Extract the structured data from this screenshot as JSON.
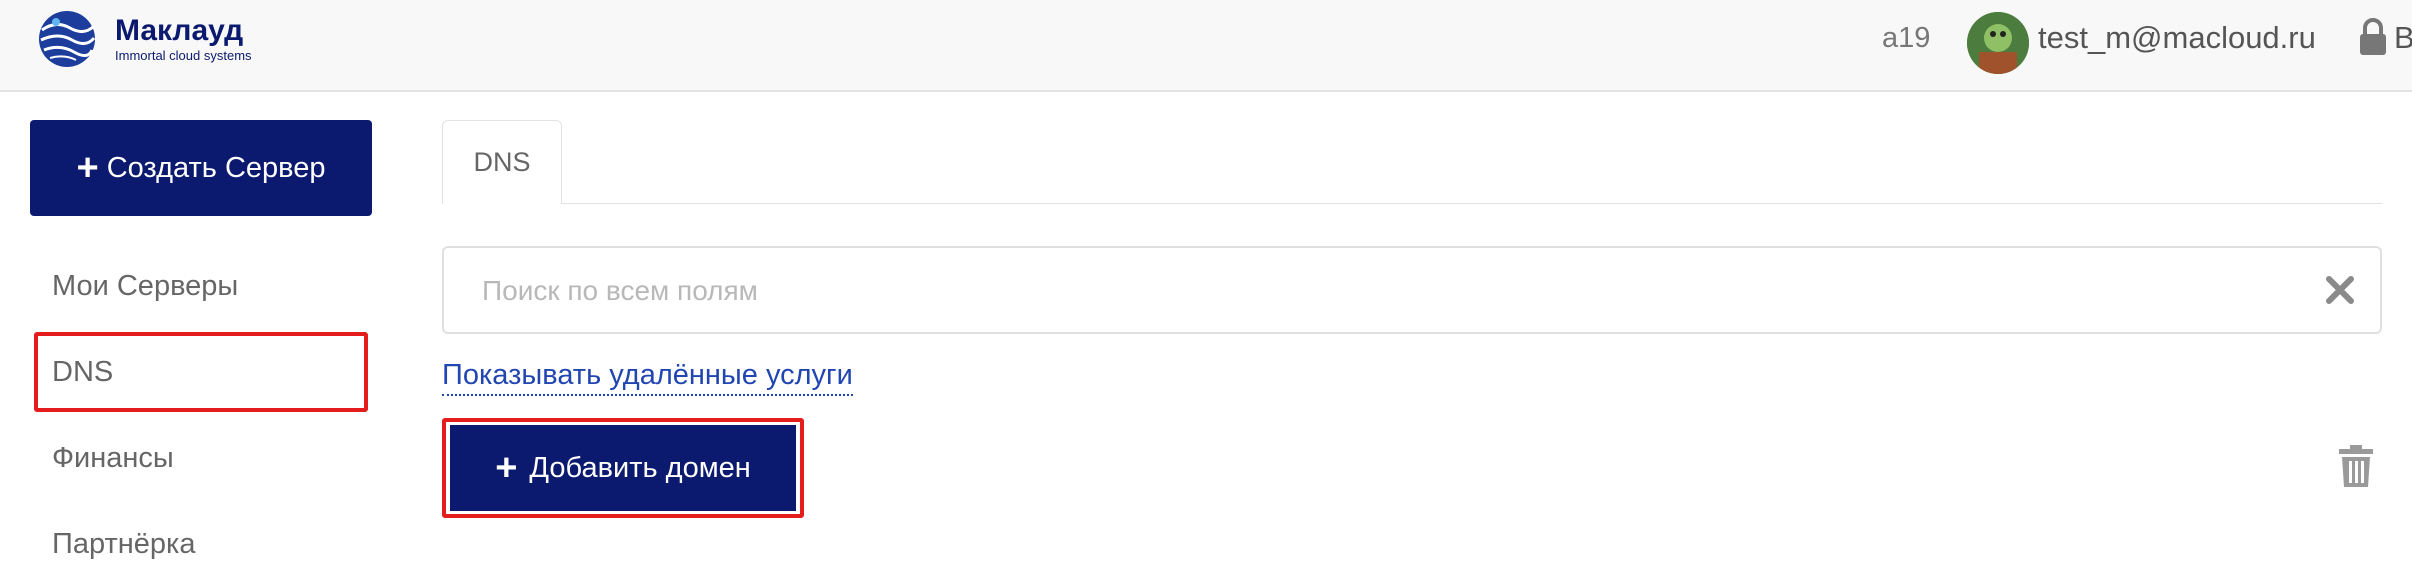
{
  "header": {
    "brand_name": "Маклауд",
    "brand_tagline": "Immortal cloud systems",
    "project": "a19",
    "user_email": "test_m@macloud.ru",
    "exit_label": "B",
    "logo_icon": "cloud-logo-icon",
    "lock_icon": "lock-icon"
  },
  "sidebar": {
    "create_button": "Создать Сервер",
    "items": [
      {
        "label": "Мои Серверы"
      },
      {
        "label": "DNS"
      },
      {
        "label": "Финансы"
      },
      {
        "label": "Партнёрка"
      }
    ]
  },
  "main": {
    "tabs": [
      {
        "label": "DNS"
      }
    ],
    "search": {
      "placeholder": "Поиск по всем полям",
      "value": ""
    },
    "show_deleted_link": "Показывать удалённые услуги",
    "add_domain_button": "Добавить домен",
    "trash_icon": "trash-icon"
  },
  "colors": {
    "primary": "#0b1a6e",
    "highlight": "#e41c1c",
    "link": "#2146b2"
  }
}
